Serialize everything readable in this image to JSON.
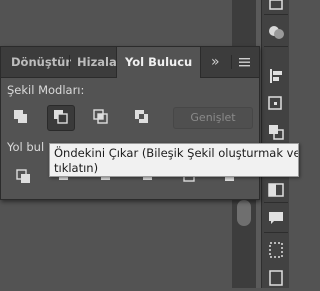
{
  "panel": {
    "tabs": [
      {
        "label": "Dönüştür",
        "active": false
      },
      {
        "label": "Hizala",
        "active": false
      },
      {
        "label": "Yol Bulucu",
        "active": true
      }
    ],
    "collapse_label": "»",
    "shape_modes_label": "Şekil Modları:",
    "shape_modes": [
      {
        "name": "unite",
        "icon": "unite-icon"
      },
      {
        "name": "minus-front",
        "icon": "minus-front-icon",
        "selected": true
      },
      {
        "name": "intersect",
        "icon": "intersect-icon"
      },
      {
        "name": "exclude",
        "icon": "exclude-icon"
      }
    ],
    "expand_label": "Genişlet",
    "pathfinders_label": "Yol bul",
    "pathfinders": [
      "divide-icon",
      "trim-icon",
      "merge-icon",
      "crop-icon",
      "outline-icon",
      "minus-back-icon"
    ]
  },
  "tooltip": {
    "line1": "Öndekini Çıkar (Bileşik Şekil oluşturmak ve",
    "line2": "tıklatın)"
  },
  "colors": {
    "panel_bg": "#535353",
    "tabbar_bg": "#3c3c3c",
    "tooltip_bg": "#f1f1f1"
  }
}
